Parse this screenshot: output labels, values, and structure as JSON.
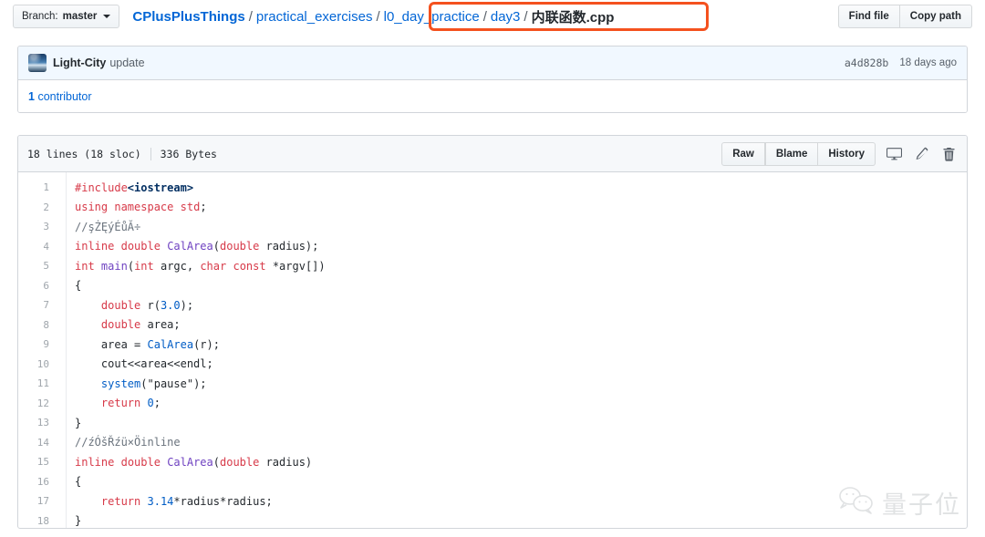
{
  "topbar": {
    "branch_prefix": "Branch:",
    "branch_name": "master",
    "breadcrumb": [
      {
        "text": "CPlusPlusThings",
        "type": "link-bold"
      },
      {
        "text": "practical_exercises",
        "type": "link"
      },
      {
        "text": "l0_day_practice",
        "type": "link"
      },
      {
        "text": "day3",
        "type": "link"
      },
      {
        "text": "内联函数.cpp",
        "type": "current"
      }
    ],
    "separator": "/",
    "find_file_label": "Find file",
    "copy_path_label": "Copy path",
    "annotation_color": "#f4511e"
  },
  "commit": {
    "author": "Light-City",
    "message": "update",
    "sha": "a4d828b",
    "time": "18 days ago",
    "contributor_count": "1",
    "contributor_label": "contributor",
    "avatar_icon": "user-avatar-image"
  },
  "file": {
    "lines_label": "18 lines (18 sloc)",
    "size_label": "336 Bytes",
    "actions": {
      "raw": "Raw",
      "blame": "Blame",
      "history": "History",
      "desktop_icon": "desktop-icon",
      "edit_icon": "pencil-icon",
      "delete_icon": "trash-icon"
    }
  },
  "code": {
    "lines": [
      {
        "no": "1",
        "tokens": [
          {
            "t": "#include",
            "c": "k"
          },
          {
            "t": "<iostream>",
            "c": "inc"
          }
        ]
      },
      {
        "no": "2",
        "tokens": [
          {
            "t": "using",
            "c": "k"
          },
          {
            "t": " ",
            "c": "s"
          },
          {
            "t": "namespace",
            "c": "k"
          },
          {
            "t": " ",
            "c": "s"
          },
          {
            "t": "std",
            "c": "k"
          },
          {
            "t": ";",
            "c": "s"
          }
        ]
      },
      {
        "no": "3",
        "tokens": [
          {
            "t": "//şŻĘýÉůĂ÷",
            "c": "cm"
          }
        ]
      },
      {
        "no": "4",
        "tokens": [
          {
            "t": "inline",
            "c": "k"
          },
          {
            "t": " ",
            "c": "s"
          },
          {
            "t": "double",
            "c": "k"
          },
          {
            "t": " ",
            "c": "s"
          },
          {
            "t": "CalArea",
            "c": "f"
          },
          {
            "t": "(",
            "c": "s"
          },
          {
            "t": "double",
            "c": "k"
          },
          {
            "t": " radius);",
            "c": "s"
          }
        ]
      },
      {
        "no": "5",
        "tokens": [
          {
            "t": "int",
            "c": "k"
          },
          {
            "t": " ",
            "c": "s"
          },
          {
            "t": "main",
            "c": "f"
          },
          {
            "t": "(",
            "c": "s"
          },
          {
            "t": "int",
            "c": "k"
          },
          {
            "t": " argc, ",
            "c": "s"
          },
          {
            "t": "char",
            "c": "k"
          },
          {
            "t": " ",
            "c": "s"
          },
          {
            "t": "const",
            "c": "k"
          },
          {
            "t": " *argv[])",
            "c": "s"
          }
        ]
      },
      {
        "no": "6",
        "tokens": [
          {
            "t": "{",
            "c": "s"
          }
        ]
      },
      {
        "no": "7",
        "tokens": [
          {
            "t": "    ",
            "c": "s"
          },
          {
            "t": "double",
            "c": "k"
          },
          {
            "t": " r(",
            "c": "s"
          },
          {
            "t": "3.0",
            "c": "n"
          },
          {
            "t": ");",
            "c": "s"
          }
        ]
      },
      {
        "no": "8",
        "tokens": [
          {
            "t": "    ",
            "c": "s"
          },
          {
            "t": "double",
            "c": "k"
          },
          {
            "t": " area;",
            "c": "s"
          }
        ]
      },
      {
        "no": "9",
        "tokens": [
          {
            "t": "    area = ",
            "c": "s"
          },
          {
            "t": "CalArea",
            "c": "c2"
          },
          {
            "t": "(r);",
            "c": "s"
          }
        ]
      },
      {
        "no": "10",
        "tokens": [
          {
            "t": "    cout<<area<<endl;",
            "c": "s"
          }
        ]
      },
      {
        "no": "11",
        "tokens": [
          {
            "t": "    ",
            "c": "s"
          },
          {
            "t": "system",
            "c": "c2"
          },
          {
            "t": "(\"pause\");",
            "c": "s"
          }
        ]
      },
      {
        "no": "12",
        "tokens": [
          {
            "t": "    ",
            "c": "s"
          },
          {
            "t": "return",
            "c": "k"
          },
          {
            "t": " ",
            "c": "s"
          },
          {
            "t": "0",
            "c": "n"
          },
          {
            "t": ";",
            "c": "s"
          }
        ]
      },
      {
        "no": "13",
        "tokens": [
          {
            "t": "}",
            "c": "s"
          }
        ]
      },
      {
        "no": "14",
        "tokens": [
          {
            "t": "//źÓšŘźü×Öinline",
            "c": "cm"
          }
        ]
      },
      {
        "no": "15",
        "tokens": [
          {
            "t": "inline",
            "c": "k"
          },
          {
            "t": " ",
            "c": "s"
          },
          {
            "t": "double",
            "c": "k"
          },
          {
            "t": " ",
            "c": "s"
          },
          {
            "t": "CalArea",
            "c": "f"
          },
          {
            "t": "(",
            "c": "s"
          },
          {
            "t": "double",
            "c": "k"
          },
          {
            "t": " radius)",
            "c": "s"
          }
        ]
      },
      {
        "no": "16",
        "tokens": [
          {
            "t": "{",
            "c": "s"
          }
        ]
      },
      {
        "no": "17",
        "tokens": [
          {
            "t": "    ",
            "c": "s"
          },
          {
            "t": "return",
            "c": "k"
          },
          {
            "t": " ",
            "c": "s"
          },
          {
            "t": "3.14",
            "c": "n"
          },
          {
            "t": "*radius*radius;",
            "c": "s"
          }
        ]
      },
      {
        "no": "18",
        "tokens": [
          {
            "t": "}",
            "c": "s"
          }
        ]
      }
    ]
  },
  "watermark": {
    "text": "量子位",
    "icon": "wechat-icon"
  }
}
